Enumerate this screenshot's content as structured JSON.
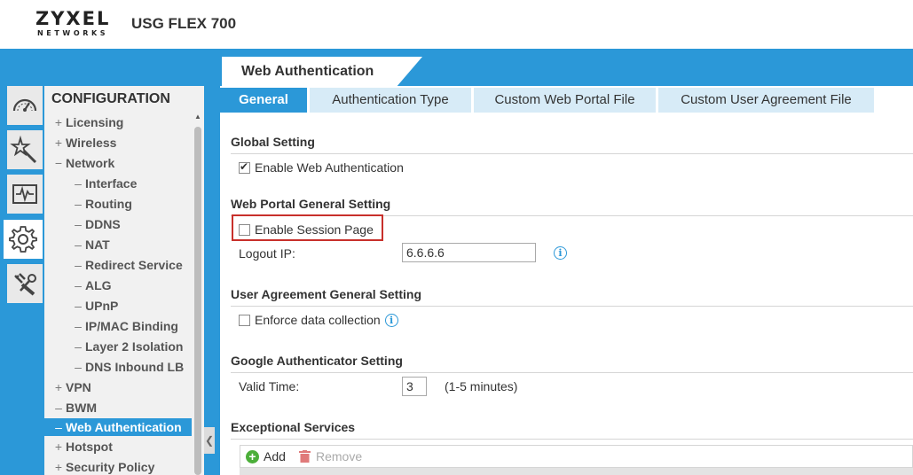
{
  "header": {
    "logo_main": "ZYXEL",
    "logo_sub": "NETWORKS",
    "model": "USG FLEX 700"
  },
  "icons": {
    "dashboard": "dashboard-icon",
    "wizard": "quick-setup-icon",
    "monitor": "monitor-icon",
    "configuration": "gear-icon",
    "maintenance": "maintenance-icon"
  },
  "nav": {
    "title": "CONFIGURATION",
    "items": [
      {
        "label": "Licensing",
        "mark": "+"
      },
      {
        "label": "Wireless",
        "mark": "+"
      },
      {
        "label": "Network",
        "mark": "−"
      },
      {
        "label": "Interface",
        "mark": "–"
      },
      {
        "label": "Routing",
        "mark": "–"
      },
      {
        "label": "DDNS",
        "mark": "–"
      },
      {
        "label": "NAT",
        "mark": "–"
      },
      {
        "label": "Redirect Service",
        "mark": "–"
      },
      {
        "label": "ALG",
        "mark": "–"
      },
      {
        "label": "UPnP",
        "mark": "–"
      },
      {
        "label": "IP/MAC Binding",
        "mark": "–"
      },
      {
        "label": "Layer 2 Isolation",
        "mark": "–"
      },
      {
        "label": "DNS Inbound LB",
        "mark": "–"
      },
      {
        "label": "VPN",
        "mark": "+"
      },
      {
        "label": "BWM",
        "mark": "–"
      },
      {
        "label": "Web Authentication",
        "mark": "–"
      },
      {
        "label": "Hotspot",
        "mark": "+"
      },
      {
        "label": "Security Policy",
        "mark": "+"
      }
    ],
    "collapse_glyph": "❮"
  },
  "page": {
    "title": "Web Authentication",
    "tabs": [
      {
        "label": "General"
      },
      {
        "label": "Authentication Type"
      },
      {
        "label": "Custom Web Portal File"
      },
      {
        "label": "Custom User Agreement File"
      }
    ]
  },
  "global_setting": {
    "heading": "Global Setting",
    "enable_web_auth_label": "Enable Web Authentication",
    "enable_web_auth_checked": true
  },
  "portal_setting": {
    "heading": "Web Portal General Setting",
    "enable_session_label": "Enable Session Page",
    "enable_session_checked": false,
    "logout_ip_label": "Logout IP:",
    "logout_ip_value": "6.6.6.6"
  },
  "agreement_setting": {
    "heading": "User Agreement General Setting",
    "enforce_label": "Enforce data collection",
    "enforce_checked": false
  },
  "google_auth": {
    "heading": "Google Authenticator Setting",
    "valid_time_label": "Valid Time:",
    "valid_time_value": "3",
    "valid_time_hint": "(1-5 minutes)"
  },
  "exceptional": {
    "heading": "Exceptional Services",
    "add_label": "Add",
    "remove_label": "Remove"
  },
  "colors": {
    "accent": "#2b98d8",
    "highlight": "#c8302b"
  }
}
